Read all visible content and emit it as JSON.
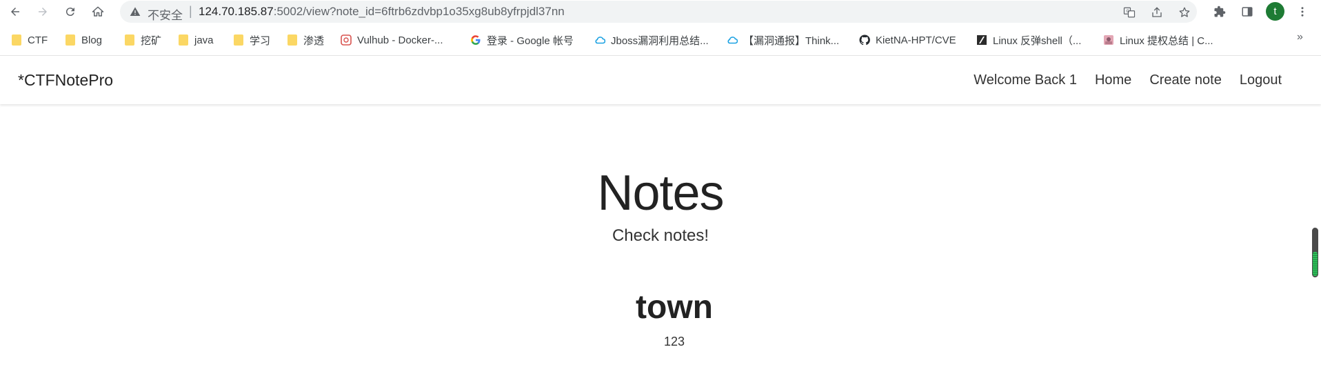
{
  "browser": {
    "security_label": "不安全",
    "separator": "|",
    "url_host": "124.70.185.87",
    "url_rest": ":5002/view?note_id=6ftrb6zdvbp1o35xg8ub8yfrpjdl37nn",
    "profile_initial": "t",
    "colors": {
      "omnibox_bg": "#f1f3f4",
      "profile_bg": "#1e7b34"
    },
    "icons": [
      "back-icon",
      "forward-icon",
      "reload-icon",
      "home-icon",
      "warning-icon",
      "translate-icon",
      "share-icon",
      "star-icon",
      "extensions-icon",
      "side-panel-icon",
      "more-icon"
    ]
  },
  "bookmarks": [
    {
      "label": "CTF",
      "icon": "folder-icon"
    },
    {
      "label": "Blog",
      "icon": "folder-icon"
    },
    {
      "label": "挖矿",
      "icon": "folder-icon"
    },
    {
      "label": "java",
      "icon": "folder-icon"
    },
    {
      "label": "学习",
      "icon": "folder-icon"
    },
    {
      "label": "渗透",
      "icon": "folder-icon"
    },
    {
      "label": "Vulhub - Docker-...",
      "icon": "vulhub-icon"
    },
    {
      "label": "登录 - Google 帐号",
      "icon": "google-icon"
    },
    {
      "label": "Jboss漏洞利用总结...",
      "icon": "cloud-icon"
    },
    {
      "label": "【漏洞通报】Think...",
      "icon": "cloud-icon"
    },
    {
      "label": "KietNA-HPT/CVE",
      "icon": "github-icon"
    },
    {
      "label": "Linux 反弹shell（...",
      "icon": "zhihu-slash-icon"
    },
    {
      "label": "Linux 提权总结 | C...",
      "icon": "image-favicon-icon"
    }
  ],
  "bookmarks_more": "»",
  "site": {
    "brand": "*CTFNotePro",
    "nav": [
      "Welcome Back 1",
      "Home",
      "Create note",
      "Logout"
    ],
    "hero_title": "Notes",
    "hero_subtitle": "Check notes!",
    "note": {
      "title": "town",
      "content": "123"
    }
  }
}
